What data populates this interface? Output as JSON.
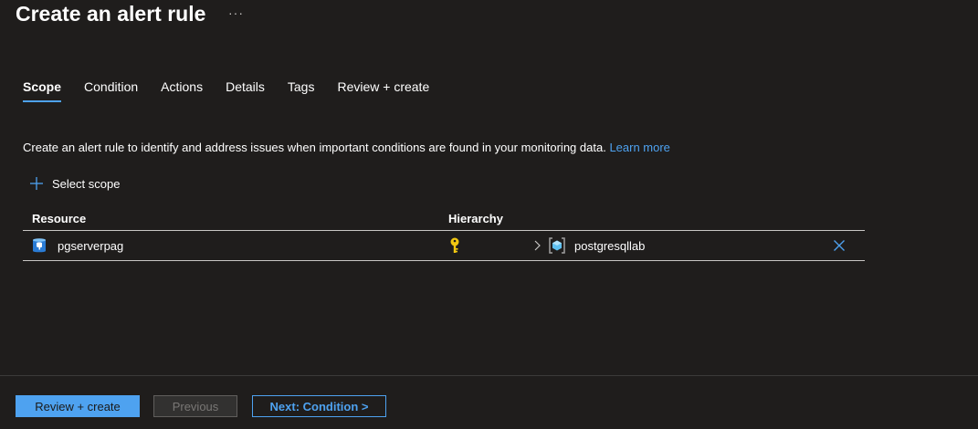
{
  "header": {
    "title": "Create an alert rule",
    "more_label": "···"
  },
  "tabs": [
    {
      "label": "Scope",
      "active": true
    },
    {
      "label": "Condition",
      "active": false
    },
    {
      "label": "Actions",
      "active": false
    },
    {
      "label": "Details",
      "active": false
    },
    {
      "label": "Tags",
      "active": false
    },
    {
      "label": "Review + create",
      "active": false
    }
  ],
  "scope": {
    "description": "Create an alert rule to identify and address issues when important conditions are found in your monitoring data.",
    "learn_more": "Learn more",
    "select_scope_label": "Select scope",
    "table": {
      "headers": {
        "resource": "Resource",
        "hierarchy": "Hierarchy"
      },
      "rows": [
        {
          "resource": "pgserverpag",
          "resource_icon": "postgresql-server-icon",
          "hierarchy_icon": "key-icon",
          "resource_group": "postgresqllab",
          "resource_group_icon": "resource-group-icon"
        }
      ]
    }
  },
  "footer": {
    "review_create": "Review + create",
    "previous": "Previous",
    "next": "Next: Condition >"
  },
  "colors": {
    "background": "#1f1d1c",
    "accent": "#4ea2f0",
    "key": "#f2c811"
  }
}
